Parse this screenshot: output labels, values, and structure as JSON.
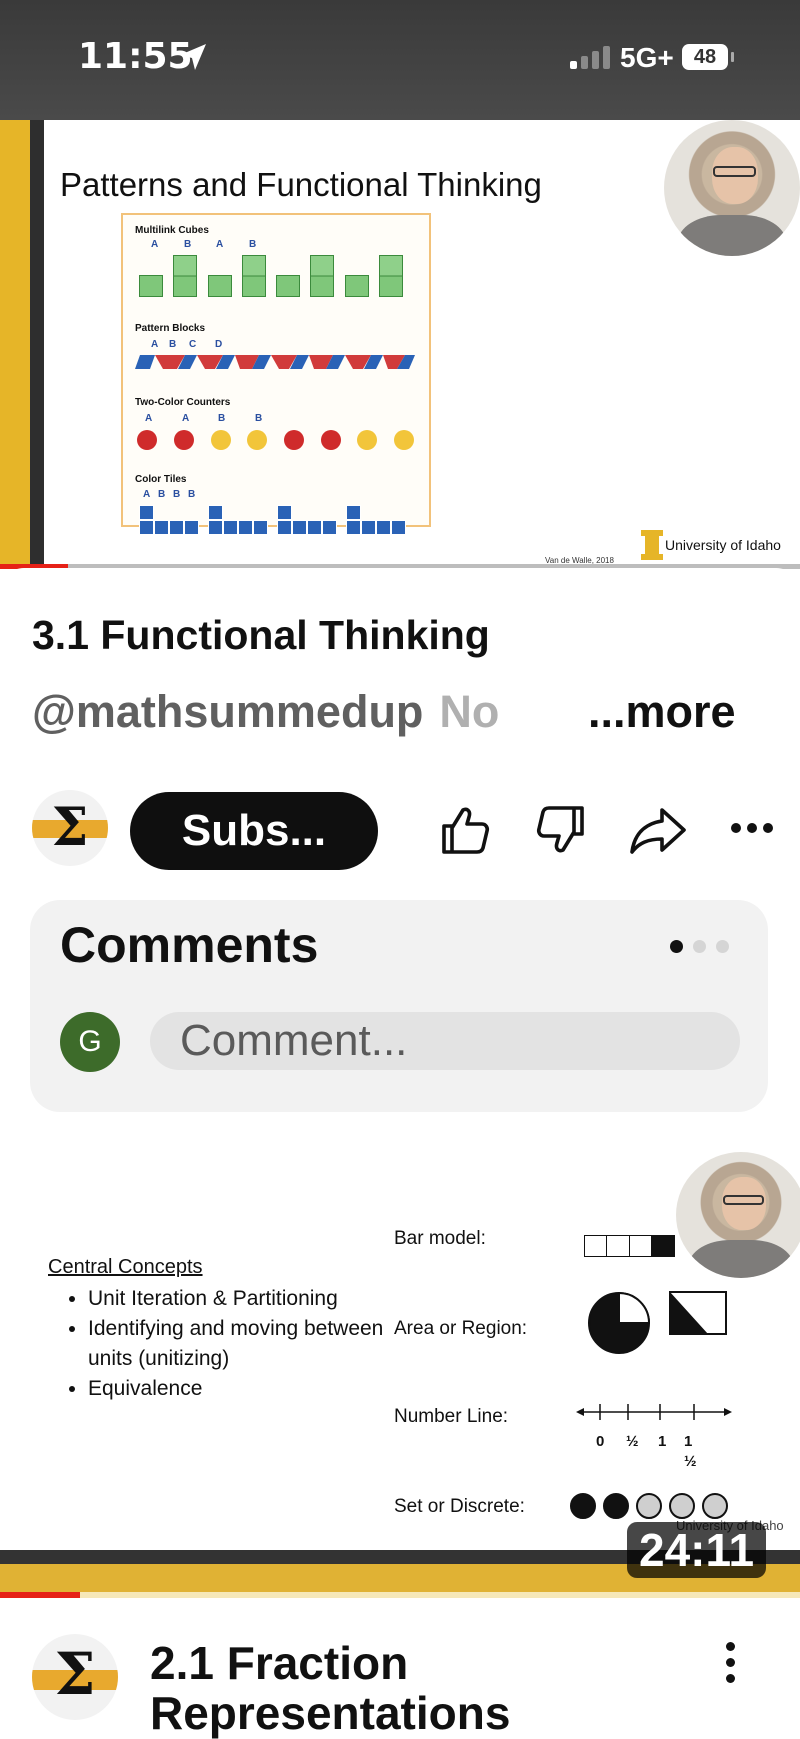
{
  "status_bar": {
    "time": "11:55",
    "network": "5G+",
    "battery": "48"
  },
  "video1": {
    "slide_title": "Patterns and Functional Thinking",
    "sections": {
      "cubes": {
        "heading": "Multilink Cubes",
        "letters": [
          "A",
          "B",
          "A",
          "B"
        ]
      },
      "blocks": {
        "heading": "Pattern Blocks",
        "letters": [
          "A",
          "B",
          "C",
          "D"
        ]
      },
      "counters": {
        "heading": "Two-Color Counters",
        "letters": [
          "A",
          "A",
          "B",
          "B"
        ]
      },
      "tiles": {
        "heading": "Color Tiles",
        "letters": [
          "A",
          "B",
          "B",
          "B"
        ]
      }
    },
    "credit": "Van de Walle, 2018",
    "logo_text": "University of Idaho",
    "progress_fraction": 0.085
  },
  "details": {
    "title": "3.1 Functional Thinking",
    "channel_handle": "@mathsummedup",
    "faded_text": "No",
    "more_label": "...more",
    "channel_avatar_symbol": "Σ",
    "subscribe_label": "Subs..."
  },
  "comments": {
    "title": "Comments",
    "avatar_letter": "G",
    "placeholder": "Comment..."
  },
  "video2": {
    "concepts_heading": "Central Concepts",
    "concepts": [
      "Unit Iteration & Partitioning",
      "Identifying and moving between units (unitizing)",
      "Equivalence"
    ],
    "representations": {
      "bar": "Bar model:",
      "area": "Area or Region:",
      "number_line": "Number Line:",
      "set": "Set or Discrete:"
    },
    "number_line_ticks": [
      "0",
      "½",
      "1",
      "1",
      "½"
    ],
    "logo_text": "University of Idaho",
    "duration": "24:11",
    "progress_fraction": 0.1
  },
  "next_video": {
    "avatar_symbol": "Σ",
    "title": "2.1 Fraction Representations"
  }
}
